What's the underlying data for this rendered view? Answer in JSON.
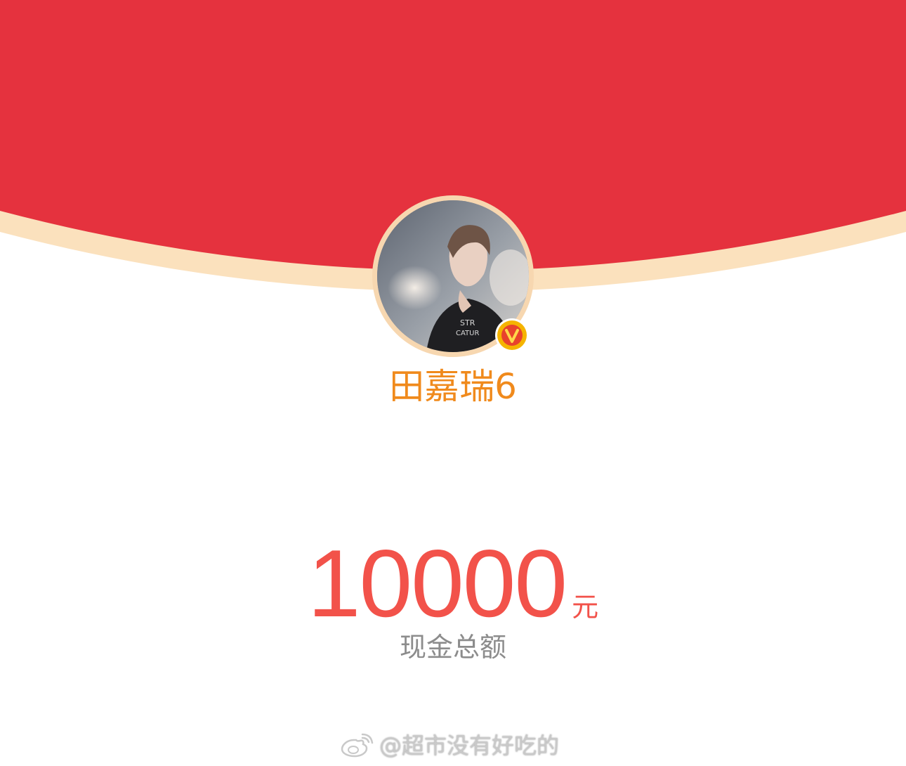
{
  "colors": {
    "header_red": "#e5323e",
    "header_rim": "#fbe1bd",
    "username_orange": "#f08a1c",
    "amount_red": "#f2524a",
    "label_gray": "#8c8c8c",
    "badge_gold": "#f5b400",
    "badge_red": "#e8432c"
  },
  "sender": {
    "name": "田嘉瑞6",
    "avatar_icon": "person-photo",
    "verified_icon": "verified-v-badge"
  },
  "amount": {
    "value": "10000",
    "unit": "元",
    "label": "现金总额"
  },
  "watermark": {
    "icon": "weibo-logo-icon",
    "text": "@超市没有好吃的"
  }
}
